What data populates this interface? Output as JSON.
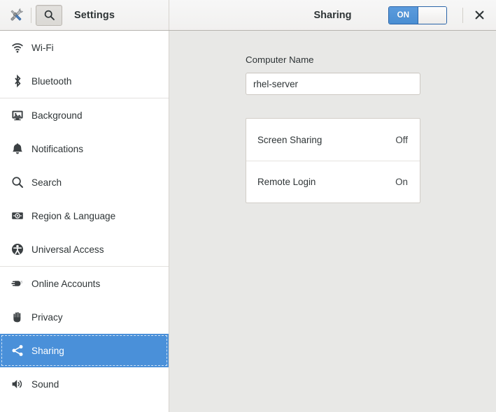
{
  "header": {
    "app_icon": "tools-icon",
    "search_icon": "search-icon",
    "app_title": "Settings",
    "panel_title": "Sharing",
    "toggle": {
      "label": "ON",
      "state": "on",
      "accent_color": "#4a8ed2"
    },
    "close_label": "×"
  },
  "sidebar": {
    "selected": "Sharing",
    "selection_color": "#4a90d9",
    "groups": [
      {
        "items": [
          {
            "label": "Wi-Fi",
            "icon": "wifi-icon"
          },
          {
            "label": "Bluetooth",
            "icon": "bluetooth-icon"
          }
        ]
      },
      {
        "items": [
          {
            "label": "Background",
            "icon": "background-monitor-icon"
          },
          {
            "label": "Notifications",
            "icon": "bell-icon"
          },
          {
            "label": "Search",
            "icon": "search-icon"
          },
          {
            "label": "Region & Language",
            "icon": "flag-icon"
          },
          {
            "label": "Universal Access",
            "icon": "accessibility-person-icon"
          }
        ]
      },
      {
        "items": [
          {
            "label": "Online Accounts",
            "icon": "plug-icon"
          },
          {
            "label": "Privacy",
            "icon": "hand-icon"
          },
          {
            "label": "Sharing",
            "icon": "share-nodes-icon"
          },
          {
            "label": "Sound",
            "icon": "speaker-icon"
          }
        ]
      }
    ]
  },
  "content": {
    "computer_name_label": "Computer Name",
    "computer_name_value": "rhel-server",
    "computer_name_placeholder": "Computer Name",
    "services": [
      {
        "title": "Screen Sharing",
        "value": "Off"
      },
      {
        "title": "Remote Login",
        "value": "On"
      }
    ]
  }
}
